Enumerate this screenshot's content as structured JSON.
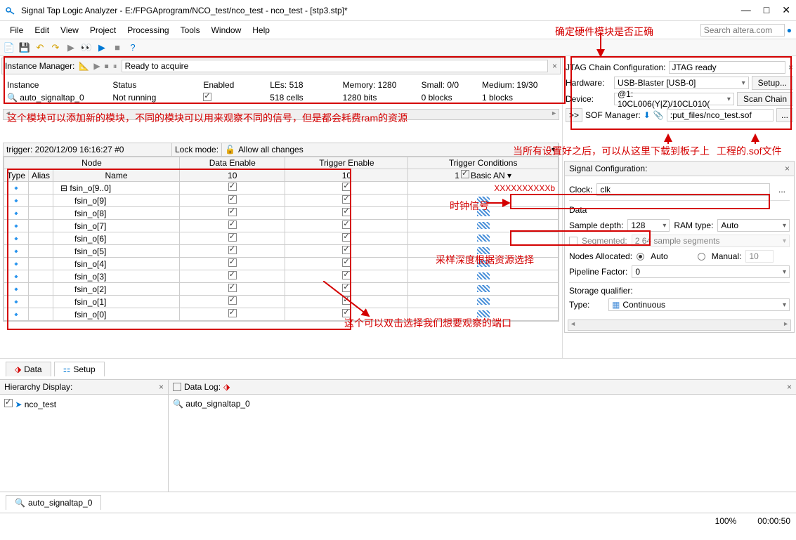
{
  "window": {
    "title": "Signal Tap Logic Analyzer - E:/FPGAprogram/NCO_test/nco_test - nco_test - [stp3.stp]*"
  },
  "menu": {
    "file": "File",
    "edit": "Edit",
    "view": "View",
    "project": "Project",
    "processing": "Processing",
    "tools": "Tools",
    "window": "Window",
    "help": "Help"
  },
  "search": {
    "placeholder": "Search altera.com"
  },
  "annot": {
    "hw_correct": "确定硬件模块是否正确",
    "module_note": "这个模块可以添加新的模块，不同的模块可以用来观察不同的信号，但是都会耗费ram的资源",
    "download_note": "当所有设置好之后，可以从这里下载到板子上",
    "sof_note": "工程的.sof文件",
    "clock_note": "时钟信号",
    "sample_note": "采样深度根据资源选择",
    "port_note": "这个可以双击选择我们想要观察的端口"
  },
  "instance_mgr": {
    "label": "Instance Manager:",
    "status": "Ready to acquire"
  },
  "inst_headers": {
    "instance": "Instance",
    "status": "Status",
    "enabled": "Enabled",
    "les": "LEs: 518",
    "memory": "Memory: 1280",
    "small": "Small: 0/0",
    "medium": "Medium: 19/30"
  },
  "inst_row": {
    "name": "auto_signaltap_0",
    "status": "Not running",
    "les": "518 cells",
    "memory": "1280 bits",
    "small": "0 blocks",
    "medium": "1 blocks"
  },
  "jtag": {
    "label": "JTAG Chain Configuration:",
    "status": "JTAG ready",
    "hw_label": "Hardware:",
    "hw_value": "USB-Blaster [USB-0]",
    "setup": "Setup...",
    "dev_label": "Device:",
    "dev_value": "@1: 10CL006(Y|Z)/10CL010(",
    "scan": "Scan Chain",
    "sof_label": "SOF Manager:",
    "sof_value": ":put_files/nco_test.sof",
    "arrow": ">>"
  },
  "trigger": {
    "timestamp": "trigger: 2020/12/09 16:16:27  #0",
    "lock_label": "Lock mode:",
    "lock_value": "Allow all changes",
    "node": "Node",
    "type": "Type",
    "alias": "Alias",
    "name": "Name",
    "data_enable": "Data Enable",
    "trigger_enable": "Trigger Enable",
    "trigger_cond": "Trigger Conditions",
    "de_val": "10",
    "te_val": "10",
    "tc_val": "1",
    "basic": "Basic AN",
    "parent": "fsin_o[9..0]",
    "parent_cond": "XXXXXXXXXXb",
    "rows": [
      "fsin_o[9]",
      "fsin_o[8]",
      "fsin_o[7]",
      "fsin_o[6]",
      "fsin_o[5]",
      "fsin_o[4]",
      "fsin_o[3]",
      "fsin_o[2]",
      "fsin_o[1]",
      "fsin_o[0]"
    ]
  },
  "sigconf": {
    "title": "Signal Configuration:",
    "clock_label": "Clock:",
    "clock_value": "clk",
    "data_section": "Data",
    "sample_label": "Sample depth:",
    "sample_value": "128",
    "ram_label": "RAM type:",
    "ram_value": "Auto",
    "seg_label": "Segmented:",
    "seg_value": "2  64 sample segments",
    "nodes_label": "Nodes Allocated:",
    "auto": "Auto",
    "manual": "Manual:",
    "manual_val": "10",
    "pipe_label": "Pipeline Factor:",
    "pipe_value": "0",
    "storage_label": "Storage qualifier:",
    "type_label": "Type:",
    "type_value": "Continuous"
  },
  "tabs": {
    "data": "Data",
    "setup": "Setup"
  },
  "hier": {
    "title": "Hierarchy Display:",
    "item": "nco_test"
  },
  "datalog": {
    "title": "Data Log:",
    "item": "auto_signaltap_0"
  },
  "bottom_tab": "auto_signaltap_0",
  "status": {
    "pct": "100%",
    "time": "00:00:50"
  }
}
